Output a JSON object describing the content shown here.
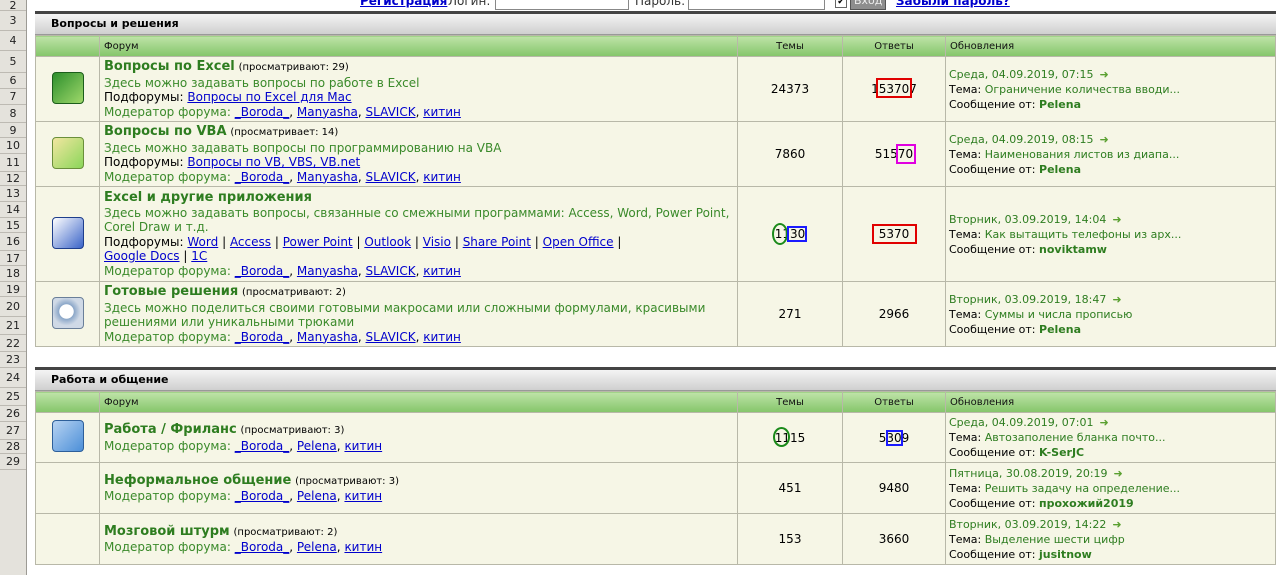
{
  "row_numbers": [
    "2",
    "3",
    "4",
    "5",
    "6",
    "7",
    "8",
    "9",
    "10",
    "11",
    "12",
    "13",
    "14",
    "15",
    "16",
    "17",
    "18",
    "19",
    "20",
    "21",
    "22",
    "23",
    "24",
    "25",
    "26",
    "27",
    "28",
    "29"
  ],
  "login": {
    "register": "Регистрация",
    "login_label": "Логин:",
    "password_label": "Пароль:",
    "enter_button": "Вход",
    "forgot": "Забыли пароль?"
  },
  "colors": {
    "accent_green": "#2e7d20",
    "link_blue": "#0000cc",
    "header_green": "#84c56a"
  },
  "columns": {
    "forum": "Форум",
    "topics": "Темы",
    "replies": "Ответы",
    "updates": "Обновления"
  },
  "sections": [
    {
      "title": "Вопросы и решения",
      "forums": [
        {
          "icon": "excel-icon",
          "title": "Вопросы по Excel",
          "viewers": "(просматривают: 29)",
          "desc": "Здесь можно задавать вопросы по работе в Excel",
          "subforums_label": "Подфорумы:",
          "subforums": [
            "Вопросы по Excel для Mac"
          ],
          "mod_label": "Модератор форума:",
          "mods": [
            "_Boroda_",
            "Manyasha",
            "SLAVICK",
            "китин"
          ],
          "topics": "24373",
          "replies": "153707",
          "upd_date": "Среда, 04.09.2019, 07:15",
          "topic_label": "Тема:",
          "topic": "Ограничение количества вводи...",
          "msg_label": "Сообщение от:",
          "user": "Pelena"
        },
        {
          "icon": "vba-icon",
          "title": "Вопросы по VBA",
          "viewers": "(просматривает: 14)",
          "desc": "Здесь можно задавать вопросы по программированию на VBA",
          "subforums_label": "Подфорумы:",
          "subforums": [
            "Вопросы по VB, VBS, VB.net"
          ],
          "mod_label": "Модератор форума:",
          "mods": [
            "_Boroda_",
            "Manyasha",
            "SLAVICK",
            "китин"
          ],
          "topics": "7860",
          "replies": "51570",
          "upd_date": "Среда, 04.09.2019, 08:15",
          "topic_label": "Тема:",
          "topic": "Наименования листов из диапа...",
          "msg_label": "Сообщение от:",
          "user": "Pelena"
        },
        {
          "icon": "word-icon",
          "title": "Excel и другие приложения",
          "viewers": "",
          "desc": "Здесь можно задавать вопросы, связанные со смежными программами: Access, Word, Power Point, Corel Draw и т.д.",
          "subforums_label": "Подфорумы:",
          "subforums": [
            "Word",
            "Access",
            "Power Point",
            "Outlook",
            "Visio",
            "Share Point",
            "Open Office",
            "Google Docs",
            "1C"
          ],
          "mod_label": "Модератор форума:",
          "mods": [
            "_Boroda_",
            "Manyasha",
            "SLAVICK",
            "китин"
          ],
          "topics": "1130",
          "replies": "5370",
          "upd_date": "Вторник, 03.09.2019, 14:04",
          "topic_label": "Тема:",
          "topic": "Как вытащить телефоны из арх...",
          "msg_label": "Сообщение от:",
          "user": "noviktamw"
        },
        {
          "icon": "magnifier-icon",
          "title": "Готовые решения",
          "viewers": "(просматривают: 2)",
          "desc": "Здесь можно поделиться своими готовыми макросами или сложными формулами, красивыми решениями или уникальными трюками",
          "mod_label": "Модератор форума:",
          "mods": [
            "_Boroda_",
            "Manyasha",
            "SLAVICK",
            "китин"
          ],
          "topics": "271",
          "replies": "2966",
          "upd_date": "Вторник, 03.09.2019, 18:47",
          "topic_label": "Тема:",
          "topic": "Суммы и числа прописью",
          "msg_label": "Сообщение от:",
          "user": "Pelena"
        }
      ]
    },
    {
      "title": "Работа и общение",
      "forums": [
        {
          "icon": "freelance-icon",
          "title": "Работа / Фриланс",
          "viewers": "(просматривают: 3)",
          "mod_label": "Модератор форума:",
          "mods": [
            "_Boroda_",
            "Pelena",
            "китин"
          ],
          "topics": "1115",
          "replies": "5309",
          "upd_date": "Среда, 04.09.2019, 07:01",
          "topic_label": "Тема:",
          "topic": "Автозаполение бланка почто...",
          "msg_label": "Сообщение от:",
          "user": "K-SerJC"
        },
        {
          "icon": "",
          "title": "Неформальное общение",
          "viewers": "(просматривают: 3)",
          "mod_label": "Модератор форума:",
          "mods": [
            "_Boroda_",
            "Pelena",
            "китин"
          ],
          "topics": "451",
          "replies": "9480",
          "upd_date": "Пятница, 30.08.2019, 20:19",
          "topic_label": "Тема:",
          "topic": "Решить задачу на определение...",
          "msg_label": "Сообщение от:",
          "user": "прохожий2019"
        },
        {
          "icon": "",
          "title": "Мозговой штурм",
          "viewers": "(просматривают: 2)",
          "mod_label": "Модератор форума:",
          "mods": [
            "_Boroda_",
            "Pelena",
            "китин"
          ],
          "topics": "153",
          "replies": "3660",
          "upd_date": "Вторник, 03.09.2019, 14:22",
          "topic_label": "Тема:",
          "topic": "Выделение шести цифр",
          "msg_label": "Сообщение от:",
          "user": "jusitnow"
        }
      ]
    }
  ]
}
